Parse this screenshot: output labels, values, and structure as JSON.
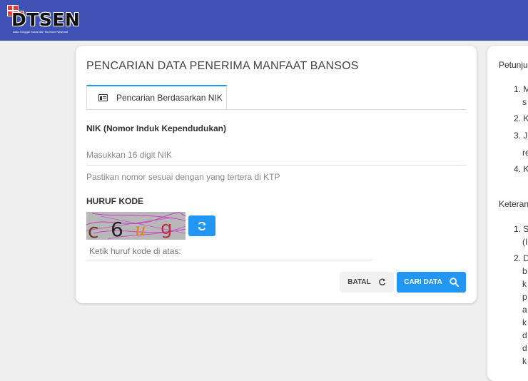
{
  "header": {
    "logo_text": "DTSEN",
    "logo_tagline": "Data Tunggal Sosial dan Ekonomi Nasional"
  },
  "form": {
    "title": "PENCARIAN DATA PENERIMA MANFAAT BANSOS",
    "tab_label": "Pencarian Berdasarkan NIK",
    "nik_label": "NIK (Nomor Induk Kependudukan)",
    "nik_placeholder": "Masukkan 16 digit NIK",
    "nik_hint": "Pastikan nomor sesuai dengan yang tertera di KTP",
    "kode_label": "HURUF KODE",
    "captcha_text": "c6ug",
    "kode_placeholder": "Ketik huruf kode di atas:",
    "batal_label": "BATAL",
    "cari_label": "CARI DATA"
  },
  "side": {
    "heading1": "Petunju",
    "items1": [
      "1. M",
      "2. K",
      "3. Ji",
      "4. K"
    ],
    "items1_cont": [
      "s",
      "re"
    ],
    "heading2": "Keteran",
    "items2": [
      "1. S",
      "2. D"
    ],
    "items2_cont": [
      "(I",
      "b",
      "k",
      "p",
      "a",
      "k",
      "d",
      "d",
      "k"
    ]
  },
  "colors": {
    "header_bg": "#3f51b5",
    "accent": "#2196f3",
    "logo_squares": "#e53935"
  },
  "icons": [
    "id-card-icon",
    "refresh-icon",
    "reload-icon",
    "search-icon"
  ]
}
